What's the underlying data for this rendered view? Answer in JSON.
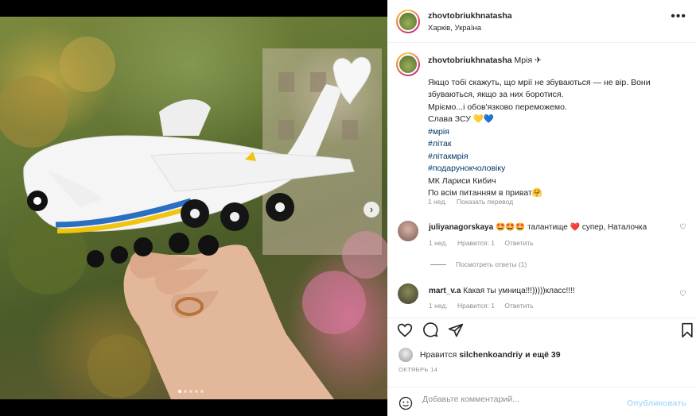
{
  "post": {
    "username": "zhovtobriukhnatasha",
    "location": "Харків, Україна",
    "more_icon": "more-icon"
  },
  "caption": {
    "username": "zhovtobriukhnatasha",
    "title": "Мрія ✈",
    "line1": "Якщо тобі скажуть, що мрії не збуваються — не вір. Вони збуваються, якщо за них боротися.",
    "line2": "Мріємо...і обов'язково переможемо.",
    "line3": "Слава ЗСУ 💛💙",
    "tags": [
      "#мрія",
      "#літак",
      "#літакмрія",
      "#подарунокчоловіку"
    ],
    "line4": "МК Лариси Кибич",
    "line5": "По всім питанням в приват🤗",
    "time": "1 нед.",
    "translate": "Показать перевод"
  },
  "comments": [
    {
      "username": "juliyanagorskaya",
      "text": "🤩🤩🤩 талантище ❤️ супер, Наталочка",
      "time": "1 нед.",
      "likes": "Нравится: 1",
      "reply": "Ответить",
      "view_replies": "Посмотреть ответы (1)"
    },
    {
      "username": "mart_v.a",
      "text": "Какая ты умница!!!)))))класс!!!!",
      "time": "1 нед.",
      "likes": "Нравится: 1",
      "reply": "Ответить"
    }
  ],
  "likes": {
    "prefix": "Нравится",
    "user": "silchenkoandriy",
    "suffix": "и ещё 39"
  },
  "date": "ОКТЯБРЬ 14",
  "add_comment": {
    "placeholder": "Добавьте комментарий...",
    "publish": "Опубликовать"
  },
  "carousel": {
    "slides": 5,
    "active": 1,
    "next_label": "›"
  },
  "colors": {
    "link": "#00376b",
    "muted": "#8e8e8e",
    "publish_disabled": "#b2dffc",
    "text": "#262626"
  }
}
